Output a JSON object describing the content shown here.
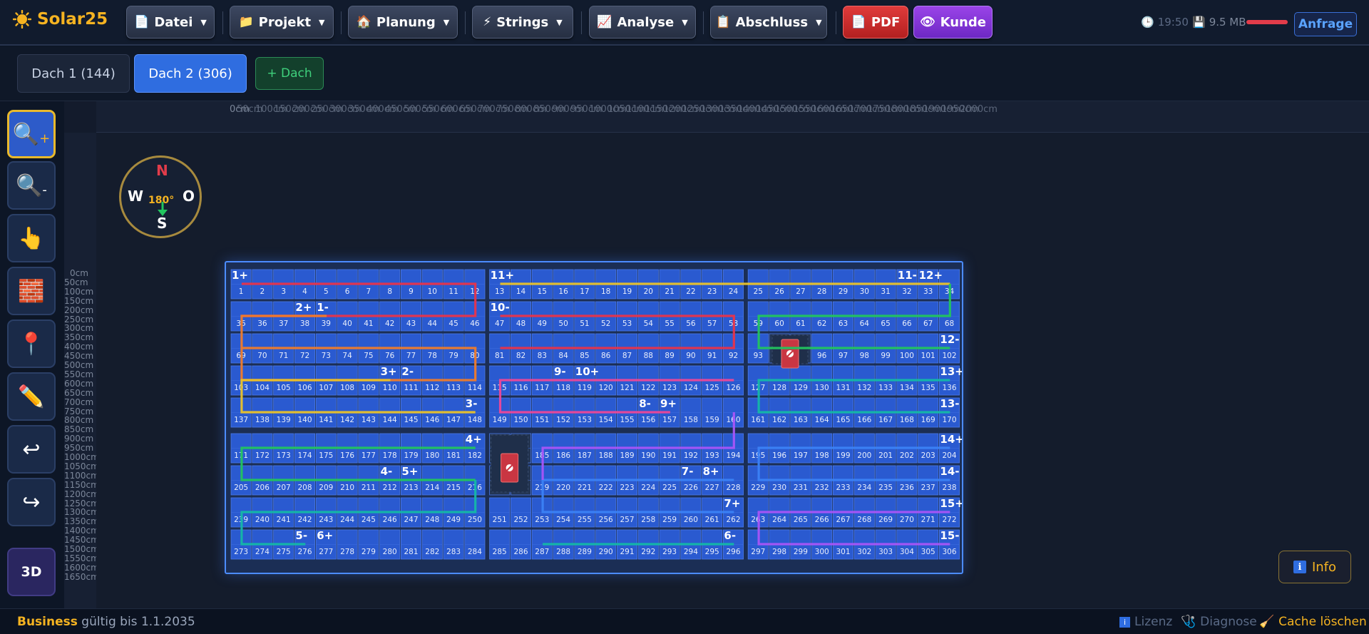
{
  "app": {
    "name": "Solar25"
  },
  "menu": [
    {
      "id": "datei",
      "icon": "📄",
      "label": "Datei"
    },
    {
      "id": "projekt",
      "icon": "📁",
      "label": "Projekt"
    },
    {
      "id": "planung",
      "icon": "🏠",
      "label": "Planung"
    },
    {
      "id": "strings",
      "icon": "⚡",
      "label": "Strings"
    },
    {
      "id": "analyse",
      "icon": "📈",
      "label": "Analyse"
    },
    {
      "id": "abschluss",
      "icon": "📋",
      "label": "Abschluss"
    }
  ],
  "actions": {
    "pdf": "PDF",
    "pdf_icon": "📄",
    "kunde": "Kunde",
    "kunde_icon": "👁",
    "anfrage": "Anfrage"
  },
  "status": {
    "time": "19:50",
    "memory": "9.5 MB"
  },
  "roof_tabs": {
    "tab1": "Dach 1 (144)",
    "tab2": "Dach 2 (306)",
    "add": "+ Dach"
  },
  "tools": [
    {
      "name": "zoom-in-tool",
      "icon": "🔍",
      "suffix": "+"
    },
    {
      "name": "zoom-out-tool",
      "icon": "🔍",
      "suffix": "-"
    },
    {
      "name": "pan-tool",
      "icon": "👆",
      "suffix": ""
    },
    {
      "name": "obstacle-tool",
      "icon": "🧱",
      "suffix": ""
    },
    {
      "name": "marker-tool",
      "icon": "📍",
      "suffix": ""
    },
    {
      "name": "draw-tool",
      "icon": "✏️",
      "suffix": ""
    },
    {
      "name": "undo-tool",
      "icon": "↩",
      "suffix": ""
    },
    {
      "name": "redo-tool",
      "icon": "↪",
      "suffix": ""
    }
  ],
  "tool_3d": "3D",
  "ruler_left": [
    "0cm",
    "50cm",
    "100cm",
    "150cm",
    "200cm",
    "250cm",
    "300cm",
    "350cm",
    "400cm",
    "450cm",
    "500cm",
    "550cm",
    "600cm",
    "650cm",
    "700cm",
    "750cm",
    "800cm",
    "850cm",
    "900cm",
    "950cm",
    "1000cm",
    "1050cm",
    "1100cm",
    "1150cm",
    "1200cm",
    "1250cm",
    "1300cm",
    "1350cm",
    "1400cm",
    "1450cm",
    "1500cm",
    "1550cm",
    "1600cm",
    "1650cm"
  ],
  "ruler_top_label": "0cm",
  "compass": {
    "north": "N",
    "south": "S",
    "west": "W",
    "east": "O",
    "azimuth": "180°"
  },
  "roof": {
    "module_count": 306,
    "row_start_numbers": [
      1,
      35,
      69,
      103,
      137,
      171,
      205,
      239,
      273
    ],
    "strings": [
      {
        "id": 1,
        "color": "#e8344a",
        "plus": "1+",
        "minus": "1-"
      },
      {
        "id": 2,
        "color": "#f07c2a",
        "plus": "2+",
        "minus": "2-"
      },
      {
        "id": 3,
        "color": "#eac32a",
        "plus": "3+",
        "minus": "3-"
      },
      {
        "id": 4,
        "color": "#22c55e",
        "plus": "4+",
        "minus": "4-"
      },
      {
        "id": 5,
        "color": "#14b8a6",
        "plus": "5+",
        "minus": "5-"
      },
      {
        "id": 6,
        "color": "#14b8a6",
        "plus": "6+",
        "minus": "6-"
      },
      {
        "id": 7,
        "color": "#3b82f6",
        "plus": "7+",
        "minus": "7-"
      },
      {
        "id": 8,
        "color": "#a855f7",
        "plus": "8+",
        "minus": "8-"
      },
      {
        "id": 9,
        "color": "#ec4899",
        "plus": "9+",
        "minus": "9-"
      },
      {
        "id": 10,
        "color": "#e8344a",
        "plus": "10+",
        "minus": "10-"
      },
      {
        "id": 11,
        "color": "#eac32a",
        "plus": "11+",
        "minus": "11-"
      },
      {
        "id": 12,
        "color": "#22c55e",
        "plus": "12+",
        "minus": "12-"
      },
      {
        "id": 13,
        "color": "#14b8a6",
        "plus": "13+",
        "minus": "13-"
      },
      {
        "id": 14,
        "color": "#3b82f6",
        "plus": "14+",
        "minus": "14-"
      },
      {
        "id": 15,
        "color": "#a855f7",
        "plus": "15+",
        "minus": "15-"
      }
    ]
  },
  "info": {
    "icon": "ℹ",
    "label": "Info"
  },
  "footer": {
    "plan": "Business",
    "valid": "gültig bis 1.1.2035",
    "lizenz": "Lizenz",
    "diagnose": "Diagnose",
    "cache": "Cache löschen"
  }
}
